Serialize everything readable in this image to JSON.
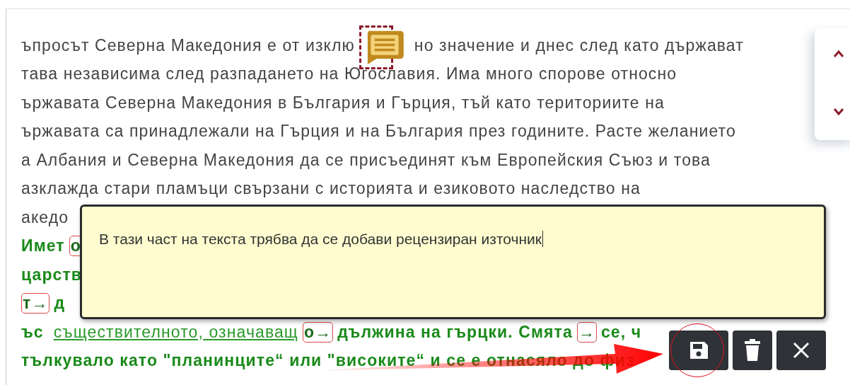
{
  "document": {
    "lines": [
      {
        "kind": "plain",
        "segments": [
          {
            "kind": "text",
            "text": "ъпросът Северна Македония е от изклю"
          },
          {
            "kind": "gap"
          },
          {
            "kind": "text",
            "text": "но значение и днес след като държават"
          }
        ]
      },
      {
        "kind": "plain",
        "segments": [
          {
            "kind": "text",
            "text": "тава независима след разпадането на Югославия. Има много спорове относно"
          }
        ]
      },
      {
        "kind": "plain",
        "segments": [
          {
            "kind": "text",
            "text": "ържавата Северна Македония в България и Гърция, тъй като териториите на"
          }
        ]
      },
      {
        "kind": "plain",
        "segments": [
          {
            "kind": "text",
            "text": "ържавата са принадлежали на Гърция и на България през годините. Расте желанието"
          }
        ]
      },
      {
        "kind": "plain",
        "segments": [
          {
            "kind": "text",
            "text": "а Албания и Северна Македония да се присъединят към Европейския Съюз и това"
          }
        ]
      },
      {
        "kind": "plain",
        "segments": [
          {
            "kind": "text",
            "text": "азклажда стари пламъци свързани с историята и езиковото наследство на"
          }
        ]
      },
      {
        "kind": "plain",
        "segments": [
          {
            "kind": "text",
            "text": "акедо"
          }
        ]
      },
      {
        "kind": "bold",
        "segments": [
          {
            "kind": "text",
            "text": "Имет"
          },
          {
            "kind": "marked",
            "text": "о"
          }
        ]
      },
      {
        "kind": "bold",
        "segments": [
          {
            "kind": "text",
            "text": "царств"
          }
        ]
      },
      {
        "kind": "bold",
        "segments": [
          {
            "kind": "marked",
            "text": "т→"
          },
          {
            "kind": "text",
            "text": "д"
          }
        ]
      },
      {
        "kind": "bold",
        "segments": [
          {
            "kind": "text",
            "text": "ъс"
          },
          {
            "kind": "link",
            "text": "съществителното,  означаващ"
          },
          {
            "kind": "marked",
            "text": "о→"
          },
          {
            "kind": "text",
            "text": "дължина на гърцки. Смята"
          },
          {
            "kind": "marked",
            "text": "→"
          },
          {
            "kind": "text",
            "text": "се, ч"
          }
        ]
      },
      {
        "kind": "bold",
        "segments": [
          {
            "kind": "text",
            "text": "тълкувало като \"планинците“ или \"високите“ и се е отнасяло до физ"
          }
        ]
      }
    ]
  },
  "comment": {
    "value": "В тази част на текста трябва да се добави рецензиран източник",
    "buttons": [
      {
        "kind": "save",
        "highlighted": true
      },
      {
        "kind": "delete",
        "highlighted": false
      },
      {
        "kind": "close",
        "highlighted": false
      }
    ]
  }
}
